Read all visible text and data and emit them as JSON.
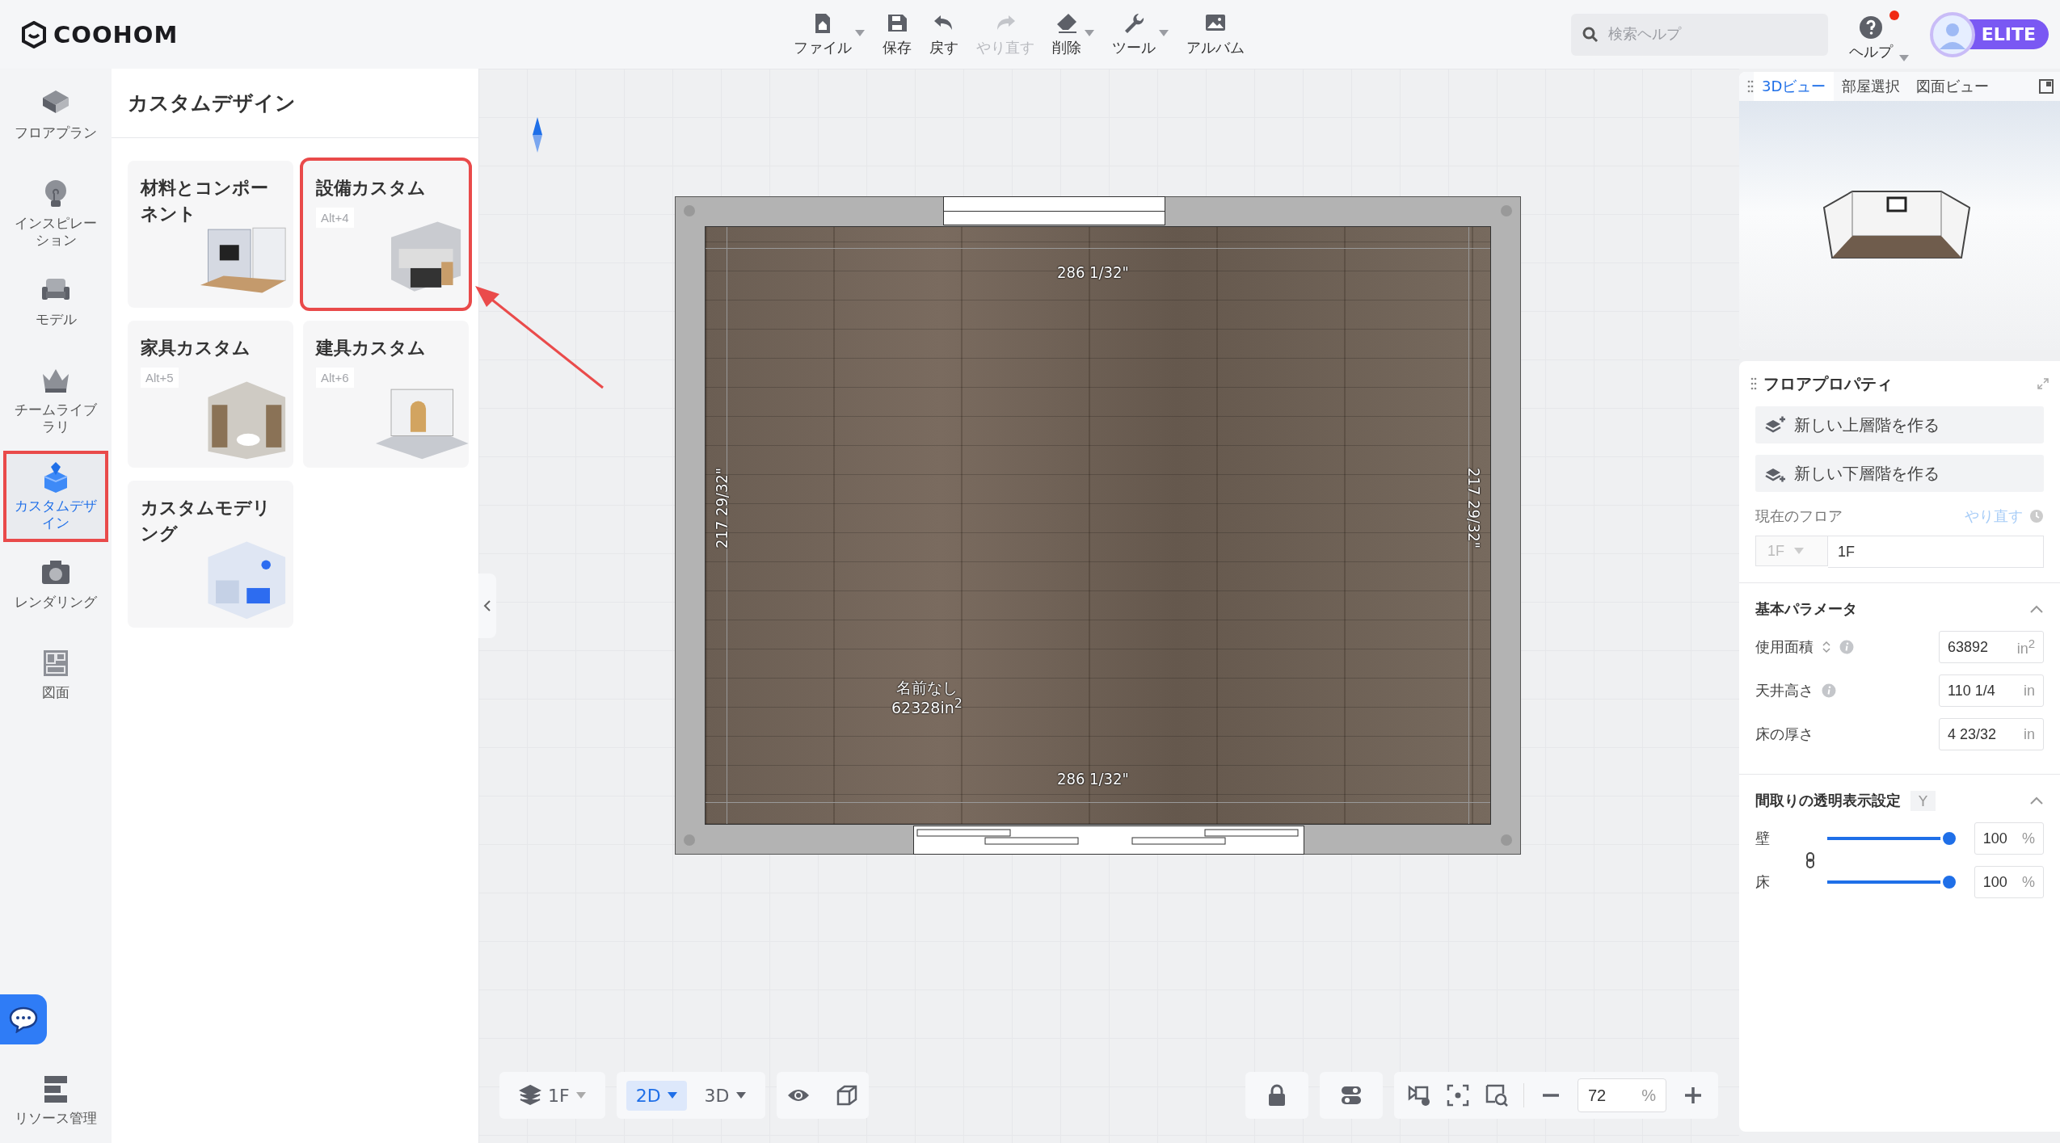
{
  "header": {
    "logo": "COOHOM",
    "tools": [
      {
        "label": "ファイル",
        "dropdown": true,
        "disabled": false
      },
      {
        "label": "保存",
        "dropdown": false,
        "disabled": false
      },
      {
        "label": "戻す",
        "dropdown": false,
        "disabled": false
      },
      {
        "label": "やり直す",
        "dropdown": false,
        "disabled": true
      },
      {
        "label": "削除",
        "dropdown": true,
        "disabled": false
      },
      {
        "label": "ツール",
        "dropdown": true,
        "disabled": false
      },
      {
        "label": "アルバム",
        "dropdown": false,
        "disabled": false
      }
    ],
    "search": {
      "placeholder": "検索ヘルプ"
    },
    "help": {
      "label": "ヘルプ",
      "notification": true
    },
    "plan_badge": "ELITE"
  },
  "nav": {
    "items": [
      {
        "label": "フロアプラン",
        "selected": false,
        "highlighted": false
      },
      {
        "label": "インスピレーション",
        "selected": false,
        "highlighted": false
      },
      {
        "label": "モデル",
        "selected": false,
        "highlighted": false
      },
      {
        "label": "チームライブラリ",
        "selected": false,
        "highlighted": false
      },
      {
        "label": "カスタムデザイン",
        "selected": true,
        "highlighted": true
      },
      {
        "label": "レンダリング",
        "selected": false,
        "highlighted": false
      },
      {
        "label": "図面",
        "selected": false,
        "highlighted": false
      }
    ],
    "footer_item": "リソース管理"
  },
  "design_panel": {
    "title": "カスタムデザイン",
    "cards": [
      {
        "title": "材料とコンポーネント",
        "highlighted": false
      },
      {
        "title": "設備カスタム",
        "shortcut": "Alt+4",
        "highlighted": true
      },
      {
        "title": "家具カスタム",
        "shortcut": "Alt+5",
        "highlighted": false
      },
      {
        "title": "建具カスタム",
        "shortcut": "Alt+6",
        "highlighted": false
      },
      {
        "title": "カスタムモデリング",
        "highlighted": false
      }
    ]
  },
  "canvas": {
    "dimensions": {
      "top": "286 1/32\"",
      "bottom": "286 1/32\"",
      "left": "217 29/32\"",
      "right": "217 29/32\""
    },
    "room": {
      "name": "名前なし",
      "area": "62328in$^{2}$"
    }
  },
  "canvas_toolbar": {
    "floor": "1F",
    "views": [
      {
        "label": "2D",
        "selected": true
      },
      {
        "label": "3D",
        "selected": false
      }
    ],
    "zoom": {
      "value": "72",
      "unit": "%"
    }
  },
  "view_panel": {
    "tabs": [
      {
        "label": "3Dビュー",
        "selected": true
      },
      {
        "label": "部屋選択",
        "selected": false
      },
      {
        "label": "図面ビュー",
        "selected": false
      }
    ]
  },
  "properties": {
    "title": "フロアプロパティ",
    "actions": [
      "新しい上層階を作る",
      "新しい下層階を作る"
    ],
    "current_floor": {
      "label": "現在のフロア",
      "redo": "やり直す",
      "select": "1F",
      "value": "1F"
    },
    "sections": [
      {
        "kind": "params",
        "title": "基本パラメータ",
        "expanded": true,
        "rows": [
          {
            "label": "使用面積",
            "sortable": true,
            "info": true,
            "value": "63892",
            "unit": "in$^{2}$"
          },
          {
            "label": "天井高さ",
            "sortable": false,
            "info": true,
            "value": "110 1/4",
            "unit": "in"
          },
          {
            "label": "床の厚さ",
            "sortable": false,
            "info": false,
            "value": "4 23/32",
            "unit": "in"
          }
        ]
      },
      {
        "kind": "sliders",
        "title": "間取りの透明表示設定",
        "shortcut": "Y",
        "expanded": true,
        "rows": [
          {
            "label": "壁",
            "level": 1,
            "value": "100",
            "unit": "%"
          },
          {
            "label": "床",
            "level": 1,
            "value": "100",
            "unit": "%"
          }
        ]
      }
    ]
  }
}
